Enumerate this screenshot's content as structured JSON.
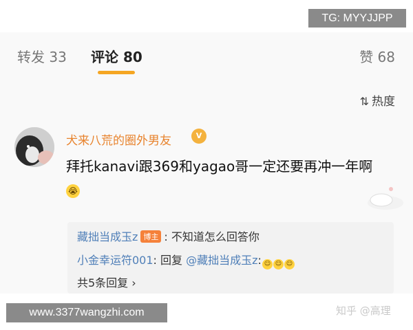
{
  "overlay": {
    "tg": "TG: MYYJJPP",
    "site": "www.3377wangzhi.com"
  },
  "tabs": [
    {
      "label": "转发 33"
    },
    {
      "label": "评论 80"
    },
    {
      "label": "赞 68"
    }
  ],
  "sort": {
    "icon": "sort-icon",
    "label": "热度"
  },
  "comment": {
    "username": "犬来八荒的圈外男友",
    "text": "拜托kanavi跟369和yagao哥一定还要再冲一年啊",
    "emoji": "cry-emoji"
  },
  "replies": [
    {
      "name": "藏拙当成玉z",
      "badge": "博主",
      "text": ": 不知道怎么回答你"
    },
    {
      "name": "小金幸运符001",
      "text": ": 回复 ",
      "mention": "@藏拙当成玉z",
      "tail": ":"
    }
  ],
  "more_replies": "共5条回复 ›",
  "watermark": "知乎 @高理",
  "colors": {
    "accent": "#f5a623",
    "username": "#e8832d",
    "link": "#4f7fb8"
  }
}
